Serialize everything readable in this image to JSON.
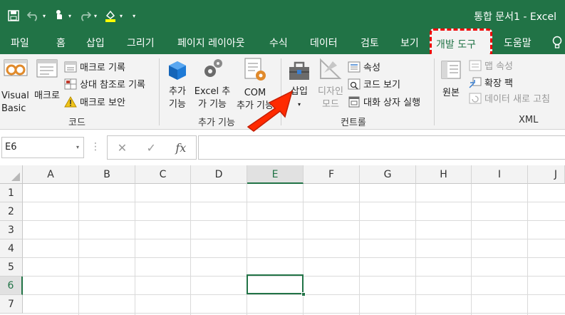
{
  "title_bar": {
    "doc_title": "통합 문서1  -  Excel",
    "qat": {
      "save": "save-icon",
      "undo": "undo-icon",
      "touch": "touch-mode-icon",
      "redo": "redo-icon",
      "fill": "fill-color-icon",
      "customize": "customize-icon"
    }
  },
  "tabs": [
    "파일",
    "홈",
    "삽입",
    "그리기",
    "페이지 레이아웃",
    "수식",
    "데이터",
    "검토",
    "보기",
    "개발 도구",
    "도움말"
  ],
  "ribbon": {
    "code_group": {
      "label": "코드",
      "visual_basic": "Visual\nBasic",
      "macro": "매크로",
      "record_macro": "매크로 기록",
      "relative_ref": "상대 참조로 기록",
      "macro_security": "매크로 보안"
    },
    "addins_group": {
      "label": "추가 기능",
      "addins": "추가\n기능",
      "excel_addins": "Excel 추\n가 기능",
      "com_addins": "COM\n추가 기능"
    },
    "controls_group": {
      "label": "컨트롤",
      "insert": "삽입",
      "design_mode": "디자인\n모드",
      "properties": "속성",
      "view_code": "코드 보기",
      "run_dialog": "대화 상자 실행"
    },
    "xml_group": {
      "label": "XML",
      "source": "원본",
      "map_properties": "맵 속성",
      "expansion_packs": "확장 팩",
      "refresh_data": "데이터 새로 고침"
    }
  },
  "formula_bar": {
    "name_box": "E6",
    "cancel": "✕",
    "enter": "✓",
    "fx": "fx",
    "value": ""
  },
  "grid": {
    "columns": [
      "A",
      "B",
      "C",
      "D",
      "E",
      "F",
      "G",
      "H",
      "I",
      "J"
    ],
    "rows": [
      "1",
      "2",
      "3",
      "4",
      "5",
      "6",
      "7"
    ],
    "selected_column": "E",
    "selected_row": "6",
    "accent": "#217346"
  },
  "colors": {
    "brand": "#217346",
    "highlight": "#e00000",
    "arrow": "#ff2a00"
  }
}
